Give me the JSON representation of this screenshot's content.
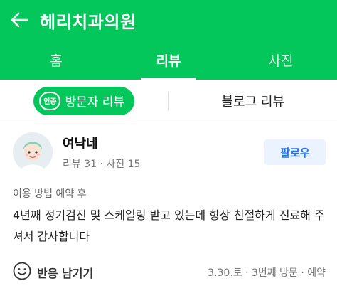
{
  "header": {
    "title": "헤리치과의원"
  },
  "tabs": [
    {
      "label": "홈"
    },
    {
      "label": "리뷰"
    },
    {
      "label": "사진"
    }
  ],
  "subtabs": {
    "badge": "인증",
    "visitor_review": "방문자 리뷰",
    "blog_review": "블로그 리뷰"
  },
  "review": {
    "user_name": "여낙네",
    "user_meta": "리뷰 31 · 사진 15",
    "follow_label": "팔로우",
    "visit_info": "이용 방법 예약 후",
    "text": "4년째 정기검진 및 스케일링 받고 있는데 항상 친절하게 진료해 주셔서 감사합니다",
    "react_label": "반응 남기기",
    "footer_info": "3.30.토 · 3번째 방문 · 예약"
  },
  "colors": {
    "brand": "#03c75a",
    "follow_bg": "#eaf3ff",
    "follow_text": "#2376e5"
  }
}
